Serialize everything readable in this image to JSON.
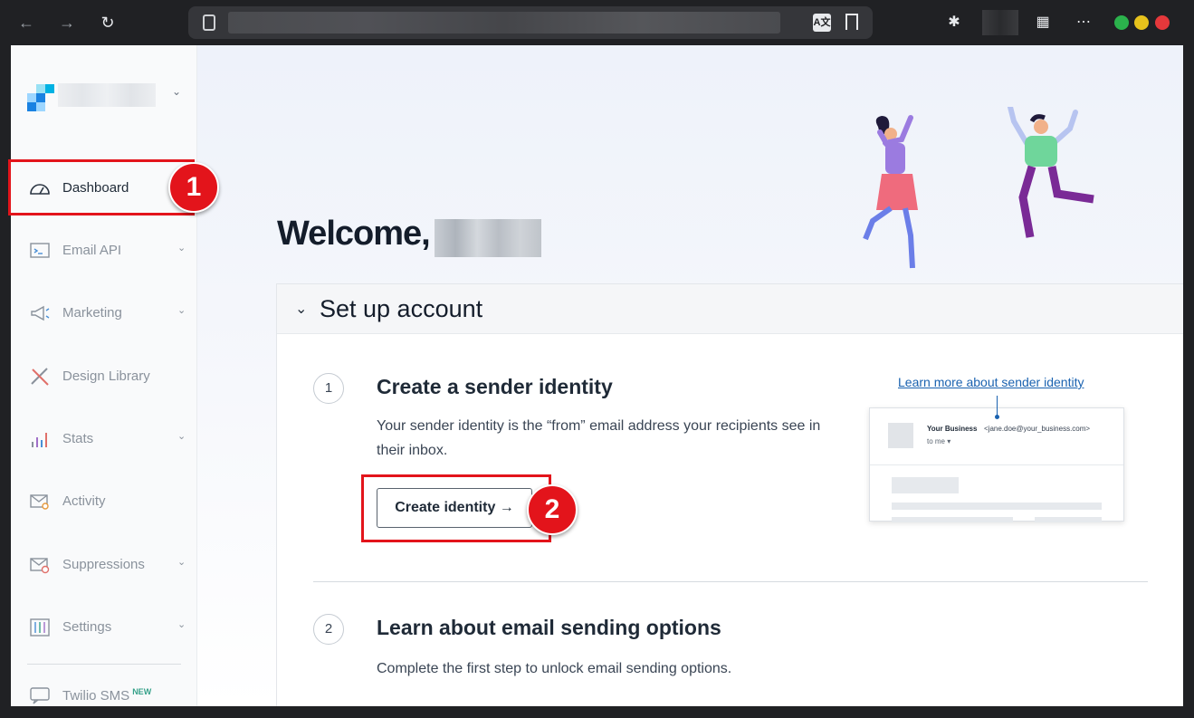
{
  "browser": {
    "back": "←",
    "forward": "→",
    "reload": "↻",
    "translate": "A文",
    "extensions": "✱",
    "grid": "▦",
    "more": "⋯"
  },
  "sidebar": {
    "items": [
      {
        "label": "Dashboard",
        "icon": "gauge-icon",
        "active": true
      },
      {
        "label": "Email API",
        "icon": "terminal-icon",
        "chevron": "⌄"
      },
      {
        "label": "Marketing",
        "icon": "megaphone-icon",
        "chevron": "⌄"
      },
      {
        "label": "Design Library",
        "icon": "pencil-ruler-icon"
      },
      {
        "label": "Stats",
        "icon": "bar-chart-icon",
        "chevron": "⌄"
      },
      {
        "label": "Activity",
        "icon": "mail-search-icon"
      },
      {
        "label": "Suppressions",
        "icon": "mail-block-icon",
        "chevron": "⌄"
      },
      {
        "label": "Settings",
        "icon": "sliders-icon",
        "chevron": "⌄"
      },
      {
        "label": "Twilio SMS",
        "icon": "chat-icon",
        "badge": "NEW"
      }
    ],
    "account_chevron": "⌄"
  },
  "main": {
    "welcome": "Welcome,",
    "setup": {
      "title": "Set up account",
      "chevron": "⌄",
      "steps": [
        {
          "number": "1",
          "title": "Create a sender identity",
          "description": "Your sender identity is the “from” email address your recipients see in their inbox.",
          "button": "Create identity →"
        },
        {
          "number": "2",
          "title": "Learn about email sending options",
          "description": "Complete the first step to unlock email sending options."
        }
      ],
      "learn_more": "Learn more about sender identity",
      "preview": {
        "from_name": "Your Business",
        "from_email": "<jane.doe@your_business.com>",
        "to": "to me ▾"
      }
    }
  },
  "annotations": {
    "badge1": "1",
    "badge2": "2",
    "color": "#e3141b"
  }
}
